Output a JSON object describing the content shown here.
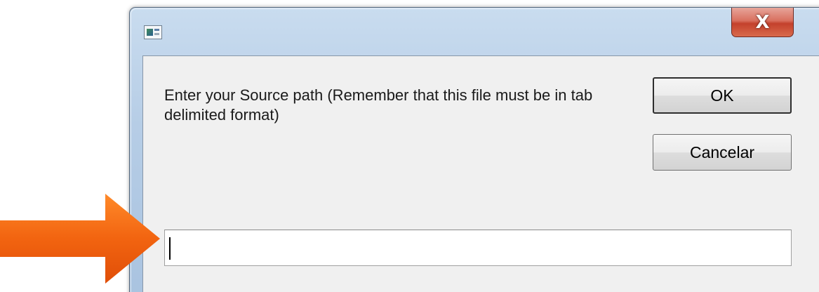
{
  "window": {
    "title": "",
    "close_glyph": "X",
    "icon": "app-window-icon"
  },
  "dialog": {
    "prompt": "Enter your Source path (Remember that this file must be in tab delimited format)",
    "ok_label": "OK",
    "cancel_label": "Cancelar",
    "input_value": "",
    "input_placeholder": ""
  },
  "annotation": {
    "icon": "arrow-right-icon",
    "color": "#f26410"
  },
  "colors": {
    "close_button": "#c4412c",
    "client_background": "#f0f0f0",
    "frame": "#b6cde6"
  }
}
